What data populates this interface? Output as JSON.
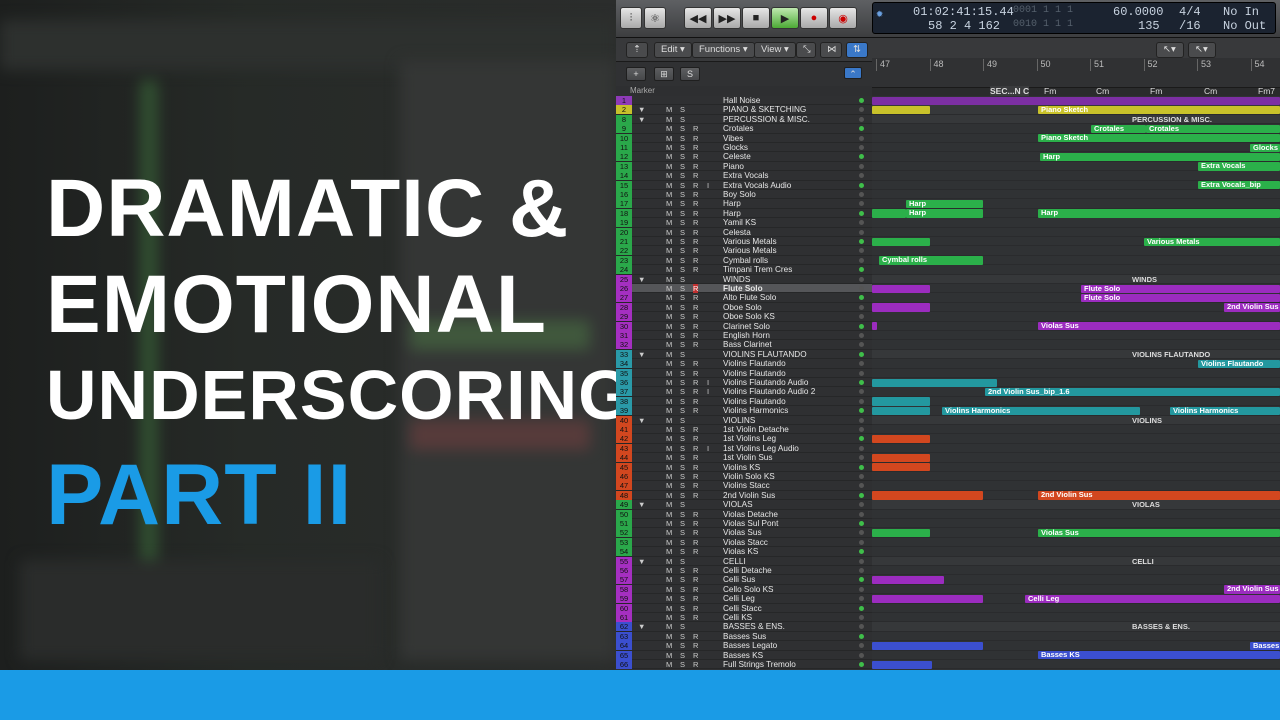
{
  "title": {
    "line1": "DRAMATIC &",
    "line2": "EMOTIONAL",
    "line3": "UNDERSCORING",
    "line4": "PART II"
  },
  "colors": {
    "accent": "#1a9be6"
  },
  "transport": {
    "time": "01:02:41:15.44",
    "time_sub": "0001 1 1 1",
    "position": "58 2 4 162",
    "position_sub": "0010 1 1 1",
    "tempo": "60.0000",
    "bpm_sub": "135",
    "signature": "4/4",
    "division": "/16",
    "in": "No In",
    "out": "No Out"
  },
  "menus": {
    "edit": "Edit",
    "functions": "Functions",
    "view": "View"
  },
  "buttons": {
    "add": "+",
    "folder": "⊞",
    "s": "S"
  },
  "marker_label": "Marker",
  "ruler": {
    "bars": [
      "47",
      "48",
      "49",
      "50",
      "51",
      "52",
      "53",
      "54"
    ],
    "section": "SEC...N C",
    "chords": [
      "Fm",
      "Cm",
      "Fm",
      "Cm",
      "Fm7"
    ]
  },
  "tracks": [
    {
      "n": "1",
      "name": "Hall Noise",
      "c": "#8e3ab8",
      "msr": ""
    },
    {
      "n": "2",
      "name": "PIANO & SKETCHING",
      "c": "#c7c02b",
      "msr": "MS"
    },
    {
      "n": "8",
      "name": "PERCUSSION & MISC.",
      "c": "#2aa84a",
      "msr": "MS"
    },
    {
      "n": "9",
      "name": "Crotales",
      "c": "#2aa84a",
      "msr": "MSR"
    },
    {
      "n": "10",
      "name": "Vibes",
      "c": "#2aa84a",
      "msr": "MSR"
    },
    {
      "n": "11",
      "name": "Glocks",
      "c": "#2aa84a",
      "msr": "MSR"
    },
    {
      "n": "12",
      "name": "Celeste",
      "c": "#2aa84a",
      "msr": "MSR"
    },
    {
      "n": "13",
      "name": "Piano",
      "c": "#2aa84a",
      "msr": "MSR"
    },
    {
      "n": "14",
      "name": "Extra Vocals",
      "c": "#2aa84a",
      "msr": "MSR"
    },
    {
      "n": "15",
      "name": "Extra Vocals Audio",
      "c": "#2aa84a",
      "msr": "MSRI"
    },
    {
      "n": "16",
      "name": "Boy Solo",
      "c": "#2aa84a",
      "msr": "MSR"
    },
    {
      "n": "17",
      "name": "Harp",
      "c": "#2aa84a",
      "msr": "MSR"
    },
    {
      "n": "18",
      "name": "Harp",
      "c": "#2aa84a",
      "msr": "MSR"
    },
    {
      "n": "19",
      "name": "Yamil KS",
      "c": "#2aa84a",
      "msr": "MSR"
    },
    {
      "n": "20",
      "name": "Celesta",
      "c": "#2aa84a",
      "msr": "MSR"
    },
    {
      "n": "21",
      "name": "Various Metals",
      "c": "#2aa84a",
      "msr": "MSR"
    },
    {
      "n": "22",
      "name": "Various Metals",
      "c": "#2aa84a",
      "msr": "MSR"
    },
    {
      "n": "23",
      "name": "Cymbal rolls",
      "c": "#2aa84a",
      "msr": "MSR"
    },
    {
      "n": "24",
      "name": "Timpani Trem Cres",
      "c": "#2aa84a",
      "msr": "MSR"
    },
    {
      "n": "25",
      "name": "WINDS",
      "c": "#a52fc1",
      "msr": "MS"
    },
    {
      "n": "26",
      "name": "Flute Solo",
      "c": "#a52fc1",
      "msr": "MSR"
    },
    {
      "n": "27",
      "name": "Alto Flute Solo",
      "c": "#a52fc1",
      "msr": "MSR"
    },
    {
      "n": "28",
      "name": "Oboe Solo",
      "c": "#a52fc1",
      "msr": "MSR"
    },
    {
      "n": "29",
      "name": "Oboe Solo KS",
      "c": "#a52fc1",
      "msr": "MSR"
    },
    {
      "n": "30",
      "name": "Clarinet Solo",
      "c": "#a52fc1",
      "msr": "MSR"
    },
    {
      "n": "31",
      "name": "English Horn",
      "c": "#a52fc1",
      "msr": "MSR"
    },
    {
      "n": "32",
      "name": "Bass Clarinet",
      "c": "#a52fc1",
      "msr": "MSR"
    },
    {
      "n": "33",
      "name": "VIOLINS FLAUTANDO",
      "c": "#2a9aa8",
      "msr": "MS"
    },
    {
      "n": "34",
      "name": "Violins Flautando",
      "c": "#2a9aa8",
      "msr": "MSR"
    },
    {
      "n": "35",
      "name": "Violins Flautando",
      "c": "#2a9aa8",
      "msr": "MSR"
    },
    {
      "n": "36",
      "name": "Violins Flautando Audio",
      "c": "#2a9aa8",
      "msr": "MSRI"
    },
    {
      "n": "37",
      "name": "Violins Flautando Audio 2",
      "c": "#2a9aa8",
      "msr": "MSRI"
    },
    {
      "n": "38",
      "name": "Violins Flautando",
      "c": "#2a9aa8",
      "msr": "MSR"
    },
    {
      "n": "39",
      "name": "Violins Harmonics",
      "c": "#2a9aa8",
      "msr": "MSR"
    },
    {
      "n": "40",
      "name": "VIOLINS",
      "c": "#d2471f",
      "msr": "MS"
    },
    {
      "n": "41",
      "name": "1st Violin Detache",
      "c": "#d2471f",
      "msr": "MSR"
    },
    {
      "n": "42",
      "name": "1st Violins Leg",
      "c": "#d2471f",
      "msr": "MSR"
    },
    {
      "n": "43",
      "name": "1st Violins Leg Audio",
      "c": "#d2471f",
      "msr": "MSRI"
    },
    {
      "n": "44",
      "name": "1st Violin Sus",
      "c": "#d2471f",
      "msr": "MSR"
    },
    {
      "n": "45",
      "name": "Violins KS",
      "c": "#d2471f",
      "msr": "MSR"
    },
    {
      "n": "46",
      "name": "Violin Solo KS",
      "c": "#d2471f",
      "msr": "MSR"
    },
    {
      "n": "47",
      "name": "Violins Stacc",
      "c": "#d2471f",
      "msr": "MSR"
    },
    {
      "n": "48",
      "name": "2nd Violin Sus",
      "c": "#d2471f",
      "msr": "MSR"
    },
    {
      "n": "49",
      "name": "VIOLAS",
      "c": "#2aa84a",
      "msr": "MS"
    },
    {
      "n": "50",
      "name": "Violas Detache",
      "c": "#2aa84a",
      "msr": "MSR"
    },
    {
      "n": "51",
      "name": "Violas Sul Pont",
      "c": "#2aa84a",
      "msr": "MSR"
    },
    {
      "n": "52",
      "name": "Violas Sus",
      "c": "#2aa84a",
      "msr": "MSR"
    },
    {
      "n": "53",
      "name": "Violas Stacc",
      "c": "#2aa84a",
      "msr": "MSR"
    },
    {
      "n": "54",
      "name": "Violas KS",
      "c": "#2aa84a",
      "msr": "MSR"
    },
    {
      "n": "55",
      "name": "CELLI",
      "c": "#a52fc1",
      "msr": "MS"
    },
    {
      "n": "56",
      "name": "Celli Detache",
      "c": "#a52fc1",
      "msr": "MSR"
    },
    {
      "n": "57",
      "name": "Celli Sus",
      "c": "#a52fc1",
      "msr": "MSR"
    },
    {
      "n": "58",
      "name": "Cello Solo KS",
      "c": "#a52fc1",
      "msr": "MSR"
    },
    {
      "n": "59",
      "name": "Celli Leg",
      "c": "#a52fc1",
      "msr": "MSR"
    },
    {
      "n": "60",
      "name": "Celli Stacc",
      "c": "#a52fc1",
      "msr": "MSR"
    },
    {
      "n": "61",
      "name": "Celli KS",
      "c": "#a52fc1",
      "msr": "MSR"
    },
    {
      "n": "62",
      "name": "BASSES & ENS.",
      "c": "#3b4fcf",
      "msr": "MS"
    },
    {
      "n": "63",
      "name": "Basses Sus",
      "c": "#3b4fcf",
      "msr": "MSR"
    },
    {
      "n": "64",
      "name": "Basses Legato",
      "c": "#3b4fcf",
      "msr": "MSR"
    },
    {
      "n": "65",
      "name": "Basses KS",
      "c": "#3b4fcf",
      "msr": "MSR"
    },
    {
      "n": "66",
      "name": "Full Strings Tremolo",
      "c": "#3b4fcf",
      "msr": "MSR"
    }
  ],
  "folder_labels": [
    {
      "row": 2,
      "text": "PERCUSSION & MISC."
    },
    {
      "row": 19,
      "text": "WINDS"
    },
    {
      "row": 27,
      "text": "VIOLINS FLAUTANDO"
    },
    {
      "row": 34,
      "text": "VIOLINS"
    },
    {
      "row": 43,
      "text": "VIOLAS"
    },
    {
      "row": 49,
      "text": "CELLI"
    },
    {
      "row": 56,
      "text": "BASSES & ENS."
    }
  ],
  "regions": [
    {
      "row": 0,
      "a": 0,
      "b": 408,
      "c": "#7c2fa3",
      "t": ""
    },
    {
      "row": 1,
      "a": 0,
      "b": 58,
      "c": "#c9c22a",
      "t": ""
    },
    {
      "row": 1,
      "a": 166,
      "b": 408,
      "c": "#c9c22a",
      "t": "Piano Sketch"
    },
    {
      "row": 3,
      "a": 219,
      "b": 274,
      "c": "#2bb04a",
      "t": "Crotales"
    },
    {
      "row": 3,
      "a": 274,
      "b": 408,
      "c": "#2bb04a",
      "t": "Crotales"
    },
    {
      "row": 4,
      "a": 166,
      "b": 408,
      "c": "#2bb04a",
      "t": "Piano Sketch"
    },
    {
      "row": 5,
      "a": 378,
      "b": 408,
      "c": "#2bb04a",
      "t": "Glocks"
    },
    {
      "row": 6,
      "a": 168,
      "b": 408,
      "c": "#2bb04a",
      "t": "Harp"
    },
    {
      "row": 7,
      "a": 326,
      "b": 408,
      "c": "#2bb04a",
      "t": "Extra Vocals"
    },
    {
      "row": 9,
      "a": 326,
      "b": 408,
      "c": "#2bb04a",
      "t": "Extra Vocals_bip"
    },
    {
      "row": 11,
      "a": 34,
      "b": 111,
      "c": "#2bb04a",
      "t": "Harp"
    },
    {
      "row": 12,
      "a": 0,
      "b": 34,
      "c": "#2bb04a",
      "t": ""
    },
    {
      "row": 12,
      "a": 34,
      "b": 111,
      "c": "#2bb04a",
      "t": "Harp"
    },
    {
      "row": 12,
      "a": 166,
      "b": 408,
      "c": "#2bb04a",
      "t": "Harp"
    },
    {
      "row": 15,
      "a": 0,
      "b": 58,
      "c": "#2bb04a",
      "t": ""
    },
    {
      "row": 15,
      "a": 272,
      "b": 408,
      "c": "#2bb04a",
      "t": "Various Metals"
    },
    {
      "row": 17,
      "a": 7,
      "b": 111,
      "c": "#2bb04a",
      "t": "Cymbal rolls"
    },
    {
      "row": 20,
      "a": 0,
      "b": 58,
      "c": "#9b2cbf",
      "t": ""
    },
    {
      "row": 20,
      "a": 209,
      "b": 408,
      "c": "#9b2cbf",
      "t": "Flute Solo"
    },
    {
      "row": 21,
      "a": 209,
      "b": 408,
      "c": "#9b2cbf",
      "t": "Flute Solo"
    },
    {
      "row": 22,
      "a": 0,
      "b": 58,
      "c": "#9b2cbf",
      "t": ""
    },
    {
      "row": 22,
      "a": 352,
      "b": 408,
      "c": "#9b2cbf",
      "t": "2nd Violin Sus"
    },
    {
      "row": 24,
      "a": 0,
      "b": 5,
      "c": "#9b2cbf",
      "t": ""
    },
    {
      "row": 24,
      "a": 166,
      "b": 408,
      "c": "#9b2cbf",
      "t": "Violas Sus"
    },
    {
      "row": 28,
      "a": 326,
      "b": 408,
      "c": "#23989f",
      "t": "Violins Flautando"
    },
    {
      "row": 30,
      "a": 0,
      "b": 125,
      "c": "#23989f",
      "t": ""
    },
    {
      "row": 31,
      "a": 113,
      "b": 408,
      "c": "#23989f",
      "t": "2nd Violin Sus_bip_1.6"
    },
    {
      "row": 32,
      "a": 0,
      "b": 58,
      "c": "#23989f",
      "t": ""
    },
    {
      "row": 33,
      "a": 0,
      "b": 58,
      "c": "#23989f",
      "t": ""
    },
    {
      "row": 33,
      "a": 70,
      "b": 268,
      "c": "#23989f",
      "t": "Violins Harmonics"
    },
    {
      "row": 33,
      "a": 298,
      "b": 408,
      "c": "#23989f",
      "t": "Violins Harmonics"
    },
    {
      "row": 36,
      "a": 0,
      "b": 58,
      "c": "#d2471f",
      "t": ""
    },
    {
      "row": 38,
      "a": 0,
      "b": 58,
      "c": "#d2471f",
      "t": ""
    },
    {
      "row": 39,
      "a": 0,
      "b": 58,
      "c": "#d2471f",
      "t": ""
    },
    {
      "row": 42,
      "a": 0,
      "b": 111,
      "c": "#d2471f",
      "t": ""
    },
    {
      "row": 42,
      "a": 166,
      "b": 408,
      "c": "#d2471f",
      "t": "2nd Violin Sus"
    },
    {
      "row": 46,
      "a": 0,
      "b": 58,
      "c": "#2bb04a",
      "t": ""
    },
    {
      "row": 46,
      "a": 166,
      "b": 408,
      "c": "#2bb04a",
      "t": "Violas Sus"
    },
    {
      "row": 51,
      "a": 0,
      "b": 72,
      "c": "#9b2cbf",
      "t": ""
    },
    {
      "row": 52,
      "a": 352,
      "b": 408,
      "c": "#9b2cbf",
      "t": "2nd Violin Sus"
    },
    {
      "row": 53,
      "a": 0,
      "b": 111,
      "c": "#9b2cbf",
      "t": ""
    },
    {
      "row": 53,
      "a": 153,
      "b": 408,
      "c": "#9b2cbf",
      "t": "Celli Leg"
    },
    {
      "row": 58,
      "a": 0,
      "b": 111,
      "c": "#3b4fcf",
      "t": ""
    },
    {
      "row": 58,
      "a": 378,
      "b": 408,
      "c": "#3b4fcf",
      "t": "Basses"
    },
    {
      "row": 59,
      "a": 166,
      "b": 408,
      "c": "#3b4fcf",
      "t": "Basses KS"
    },
    {
      "row": 60,
      "a": 0,
      "b": 60,
      "c": "#3b4fcf",
      "t": ""
    }
  ]
}
